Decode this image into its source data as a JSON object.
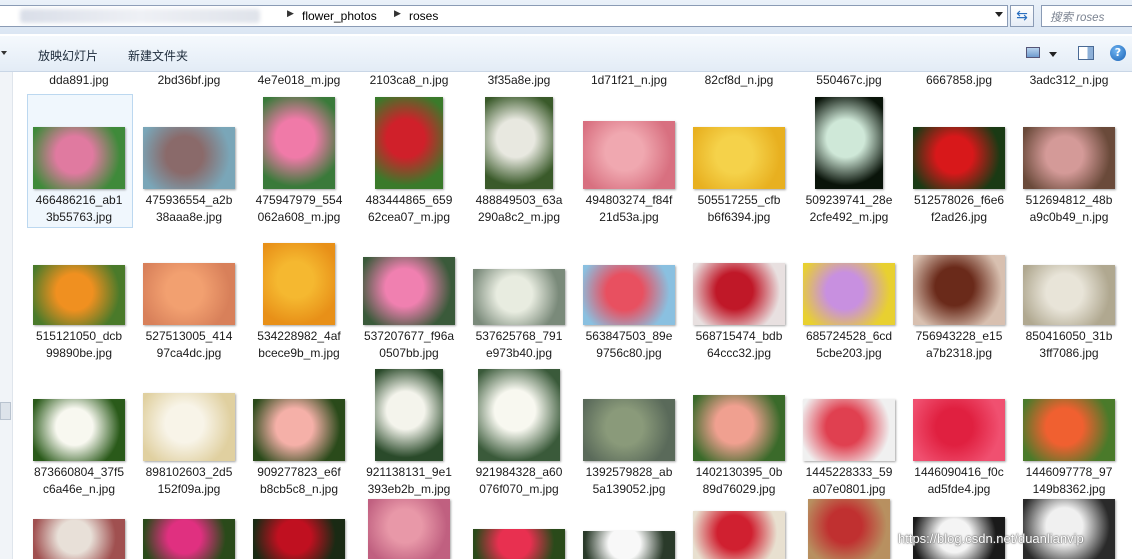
{
  "address": {
    "crumbs": [
      "flower_photos",
      "roses"
    ]
  },
  "search": {
    "placeholder": "搜索 roses"
  },
  "toolbar": {
    "slideshow": "放映幻灯片",
    "new_folder": "新建文件夹"
  },
  "top_row": [
    "dda891.jpg",
    "2bd36bf.jpg",
    "4e7e018_m.jpg",
    "2103ca8_n.jpg",
    "3f35a8e.jpg",
    "1d71f21_n.jpg",
    "82cf8d_n.jpg",
    "550467c.jpg",
    "6667858.jpg",
    "3adc312_n.jpg"
  ],
  "rows": [
    [
      {
        "l1": "466486216_ab1",
        "l2": "3b55763.jpg",
        "c": [
          "#e07aa0",
          "#3f8a3a"
        ],
        "sel": true
      },
      {
        "l1": "475936554_a2b",
        "l2": "38aaa8e.jpg",
        "c": [
          "#8a6a6a",
          "#7aa6b8"
        ]
      },
      {
        "l1": "475947979_554",
        "l2": "062a608_m.jpg",
        "c": [
          "#f07aa8",
          "#3a7a3a"
        ]
      },
      {
        "l1": "483444865_659",
        "l2": "62cea07_m.jpg",
        "c": [
          "#d0202a",
          "#3a7a2a"
        ]
      },
      {
        "l1": "488849503_63a",
        "l2": "290a8c2_m.jpg",
        "c": [
          "#e8e8e0",
          "#3a5a2a"
        ]
      },
      {
        "l1": "494803274_f84f",
        "l2": "21d53a.jpg",
        "c": [
          "#f0a8b0",
          "#d87080"
        ]
      },
      {
        "l1": "505517255_cfb",
        "l2": "b6f6394.jpg",
        "c": [
          "#f5d24a",
          "#e8b020"
        ]
      },
      {
        "l1": "509239741_28e",
        "l2": "2cfe492_m.jpg",
        "c": [
          "#cfe8d8",
          "#0a140a"
        ]
      },
      {
        "l1": "512578026_f6e6",
        "l2": "f2ad26.jpg",
        "c": [
          "#d8181a",
          "#1a3a14"
        ]
      },
      {
        "l1": "512694812_48b",
        "l2": "a9c0b49_n.jpg",
        "c": [
          "#d49a98",
          "#6a4a3a"
        ]
      }
    ],
    [
      {
        "l1": "515121050_dcb",
        "l2": "99890be.jpg",
        "c": [
          "#f09020",
          "#4a7a2a"
        ]
      },
      {
        "l1": "527513005_414",
        "l2": "97ca4dc.jpg",
        "c": [
          "#f2a070",
          "#d8805a"
        ]
      },
      {
        "l1": "534228982_4af",
        "l2": "bcece9b_m.jpg",
        "c": [
          "#f5b830",
          "#e89018"
        ]
      },
      {
        "l1": "537207677_f96a",
        "l2": "0507bb.jpg",
        "c": [
          "#f080b0",
          "#3a5a3a"
        ]
      },
      {
        "l1": "537625768_791",
        "l2": "e973b40.jpg",
        "c": [
          "#e8ece0",
          "#7a8a7a"
        ]
      },
      {
        "l1": "563847503_89e",
        "l2": "9756c80.jpg",
        "c": [
          "#e85060",
          "#8ac0e0"
        ]
      },
      {
        "l1": "568715474_bdb",
        "l2": "64ccc32.jpg",
        "c": [
          "#c01828",
          "#e8e0e0"
        ]
      },
      {
        "l1": "685724528_6cd",
        "l2": "5cbe203.jpg",
        "c": [
          "#c890e0",
          "#e8d030"
        ]
      },
      {
        "l1": "756943228_e15",
        "l2": "a7b2318.jpg",
        "c": [
          "#6a2a1a",
          "#d8c0b0"
        ]
      },
      {
        "l1": "850416050_31b",
        "l2": "3ff7086.jpg",
        "c": [
          "#e8e4d8",
          "#b0a890"
        ]
      }
    ],
    [
      {
        "l1": "873660804_37f5",
        "l2": "c6a46e_n.jpg",
        "c": [
          "#f8f8f0",
          "#2a5a1a"
        ]
      },
      {
        "l1": "898102603_2d5",
        "l2": "152f09a.jpg",
        "c": [
          "#f8f4e8",
          "#e0d0a0"
        ]
      },
      {
        "l1": "909277823_e6f",
        "l2": "b8cb5c8_n.jpg",
        "c": [
          "#f5b0a8",
          "#2a4a1a"
        ]
      },
      {
        "l1": "921138131_9e1",
        "l2": "393eb2b_m.jpg",
        "c": [
          "#f4f4ec",
          "#2a4a2a"
        ]
      },
      {
        "l1": "921984328_a60",
        "l2": "076f070_m.jpg",
        "c": [
          "#f8f8f0",
          "#3a5a3a"
        ]
      },
      {
        "l1": "1392579828_ab",
        "l2": "5a139052.jpg",
        "c": [
          "#8a9a7a",
          "#5a6a5a"
        ]
      },
      {
        "l1": "1402130395_0b",
        "l2": "89d76029.jpg",
        "c": [
          "#f0a090",
          "#3a6a2a"
        ]
      },
      {
        "l1": "1445228333_59",
        "l2": "a07e0801.jpg",
        "c": [
          "#e04050",
          "#f0f0f0"
        ]
      },
      {
        "l1": "1446090416_f0c",
        "l2": "ad5fde4.jpg",
        "c": [
          "#e02040",
          "#f05070"
        ]
      },
      {
        "l1": "1446097778_97",
        "l2": "149b8362.jpg",
        "c": [
          "#f06030",
          "#4a7a2a"
        ]
      }
    ],
    [
      {
        "l1": "",
        "l2": "",
        "c": [
          "#e8e0d8",
          "#a05050"
        ]
      },
      {
        "l1": "",
        "l2": "",
        "c": [
          "#e03080",
          "#2a4a1a"
        ]
      },
      {
        "l1": "",
        "l2": "",
        "c": [
          "#c01020",
          "#1a2a14"
        ]
      },
      {
        "l1": "",
        "l2": "",
        "c": [
          "#e898a8",
          "#c06080"
        ]
      },
      {
        "l1": "",
        "l2": "",
        "c": [
          "#e83050",
          "#2a4a1a"
        ]
      },
      {
        "l1": "",
        "l2": "",
        "c": [
          "#f8f8f8",
          "#2a3a2a"
        ]
      },
      {
        "l1": "",
        "l2": "",
        "c": [
          "#d02030",
          "#e8e0d0"
        ]
      },
      {
        "l1": "",
        "l2": "",
        "c": [
          "#c03030",
          "#b89060"
        ]
      },
      {
        "l1": "",
        "l2": "",
        "c": [
          "#f4f4f4",
          "#1a1a1a"
        ]
      },
      {
        "l1": "",
        "l2": "",
        "c": [
          "#f0f0f0",
          "#2a2a2a"
        ]
      }
    ]
  ],
  "watermark": "https://blog.csdn.net/duanlianvip"
}
